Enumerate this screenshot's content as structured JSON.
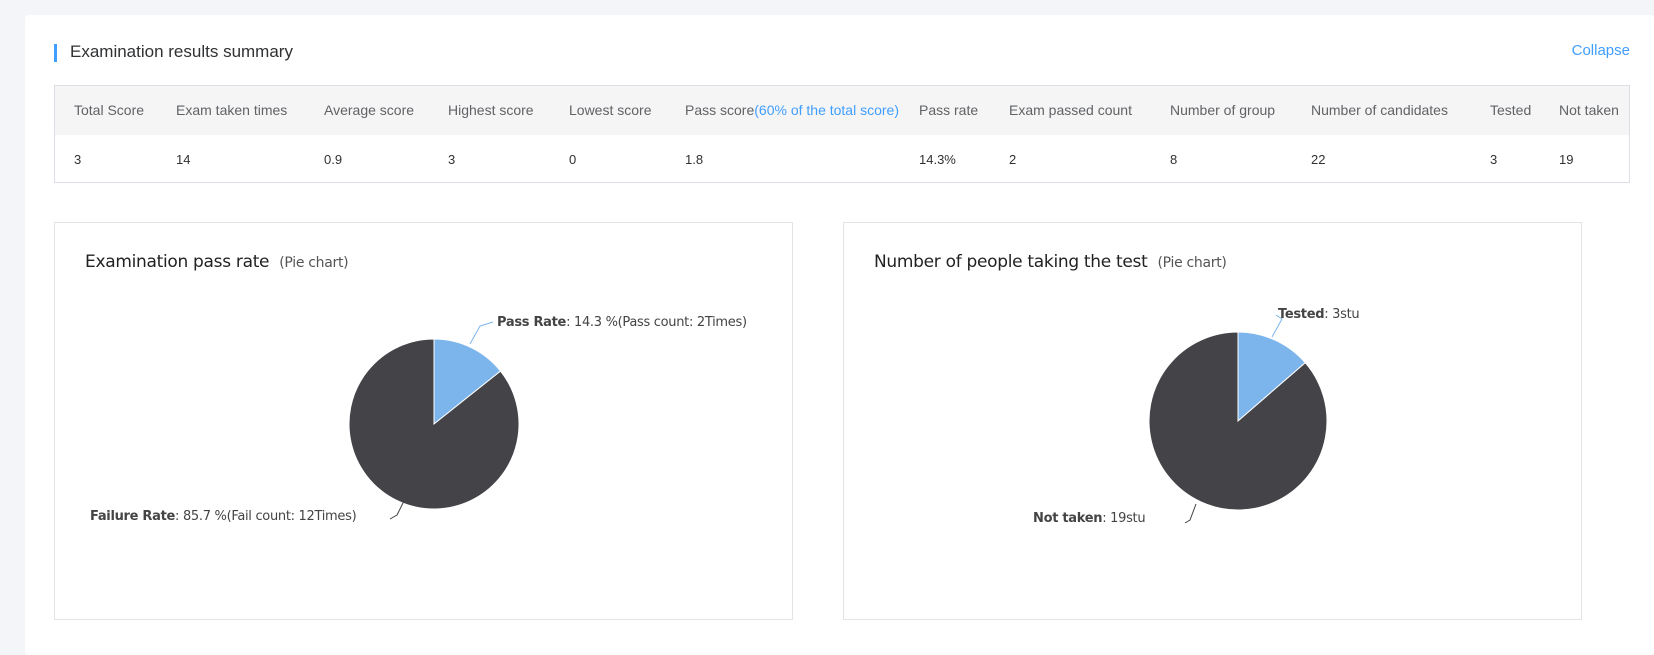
{
  "section": {
    "title": "Examination results summary",
    "collapse_label": "Collapse"
  },
  "table": {
    "headers": [
      "Total Score",
      "Exam taken times",
      "Average score",
      "Highest score",
      "Lowest score",
      "Pass score",
      "Pass rate",
      "Exam passed count",
      "Number of group",
      "Number of candidates",
      "Tested",
      "Not taken"
    ],
    "pass_score_note": "(60% of the total score)",
    "values": [
      "3",
      "14",
      "0.9",
      "3",
      "0",
      "1.8",
      "14.3%",
      "2",
      "8",
      "22",
      "3",
      "19"
    ]
  },
  "colors": {
    "accent": "#409eff",
    "slice_light": "#7cb5ec",
    "slice_dark": "#434348"
  },
  "chart_data": [
    {
      "type": "pie",
      "title": "Examination pass rate",
      "subtitle": "(Pie chart)",
      "slices": [
        {
          "name": "Pass Rate",
          "value": 14.3,
          "label_name": "Pass Rate",
          "label_text": ": 14.3 %(Pass count: 2Times)",
          "color": "#7cb5ec"
        },
        {
          "name": "Failure Rate",
          "value": 85.7,
          "label_name": "Failure Rate",
          "label_text": ": 85.7 %(Fail count: 12Times)",
          "color": "#434348"
        }
      ]
    },
    {
      "type": "pie",
      "title": "Number of people taking the test",
      "subtitle": "(Pie chart)",
      "slices": [
        {
          "name": "Tested",
          "value": 3,
          "label_name": "Tested",
          "label_text": ": 3stu",
          "color": "#7cb5ec"
        },
        {
          "name": "Not taken",
          "value": 19,
          "label_name": "Not taken",
          "label_text": ": 19stu",
          "color": "#434348"
        }
      ]
    }
  ]
}
